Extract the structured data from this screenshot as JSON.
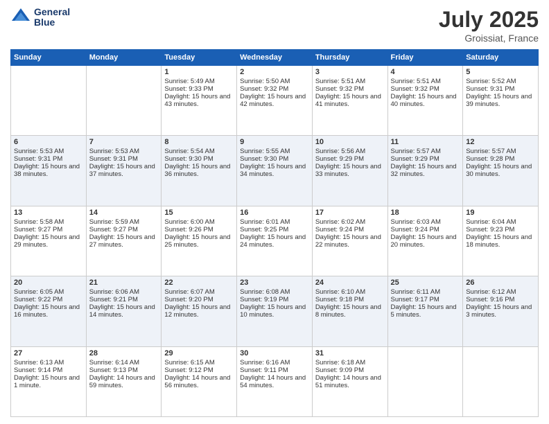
{
  "header": {
    "logo_line1": "General",
    "logo_line2": "Blue",
    "month_year": "July 2025",
    "location": "Groissiat, France"
  },
  "days_of_week": [
    "Sunday",
    "Monday",
    "Tuesday",
    "Wednesday",
    "Thursday",
    "Friday",
    "Saturday"
  ],
  "weeks": [
    [
      {
        "day": "",
        "sunrise": "",
        "sunset": "",
        "daylight": ""
      },
      {
        "day": "",
        "sunrise": "",
        "sunset": "",
        "daylight": ""
      },
      {
        "day": "1",
        "sunrise": "Sunrise: 5:49 AM",
        "sunset": "Sunset: 9:33 PM",
        "daylight": "Daylight: 15 hours and 43 minutes."
      },
      {
        "day": "2",
        "sunrise": "Sunrise: 5:50 AM",
        "sunset": "Sunset: 9:32 PM",
        "daylight": "Daylight: 15 hours and 42 minutes."
      },
      {
        "day": "3",
        "sunrise": "Sunrise: 5:51 AM",
        "sunset": "Sunset: 9:32 PM",
        "daylight": "Daylight: 15 hours and 41 minutes."
      },
      {
        "day": "4",
        "sunrise": "Sunrise: 5:51 AM",
        "sunset": "Sunset: 9:32 PM",
        "daylight": "Daylight: 15 hours and 40 minutes."
      },
      {
        "day": "5",
        "sunrise": "Sunrise: 5:52 AM",
        "sunset": "Sunset: 9:31 PM",
        "daylight": "Daylight: 15 hours and 39 minutes."
      }
    ],
    [
      {
        "day": "6",
        "sunrise": "Sunrise: 5:53 AM",
        "sunset": "Sunset: 9:31 PM",
        "daylight": "Daylight: 15 hours and 38 minutes."
      },
      {
        "day": "7",
        "sunrise": "Sunrise: 5:53 AM",
        "sunset": "Sunset: 9:31 PM",
        "daylight": "Daylight: 15 hours and 37 minutes."
      },
      {
        "day": "8",
        "sunrise": "Sunrise: 5:54 AM",
        "sunset": "Sunset: 9:30 PM",
        "daylight": "Daylight: 15 hours and 36 minutes."
      },
      {
        "day": "9",
        "sunrise": "Sunrise: 5:55 AM",
        "sunset": "Sunset: 9:30 PM",
        "daylight": "Daylight: 15 hours and 34 minutes."
      },
      {
        "day": "10",
        "sunrise": "Sunrise: 5:56 AM",
        "sunset": "Sunset: 9:29 PM",
        "daylight": "Daylight: 15 hours and 33 minutes."
      },
      {
        "day": "11",
        "sunrise": "Sunrise: 5:57 AM",
        "sunset": "Sunset: 9:29 PM",
        "daylight": "Daylight: 15 hours and 32 minutes."
      },
      {
        "day": "12",
        "sunrise": "Sunrise: 5:57 AM",
        "sunset": "Sunset: 9:28 PM",
        "daylight": "Daylight: 15 hours and 30 minutes."
      }
    ],
    [
      {
        "day": "13",
        "sunrise": "Sunrise: 5:58 AM",
        "sunset": "Sunset: 9:27 PM",
        "daylight": "Daylight: 15 hours and 29 minutes."
      },
      {
        "day": "14",
        "sunrise": "Sunrise: 5:59 AM",
        "sunset": "Sunset: 9:27 PM",
        "daylight": "Daylight: 15 hours and 27 minutes."
      },
      {
        "day": "15",
        "sunrise": "Sunrise: 6:00 AM",
        "sunset": "Sunset: 9:26 PM",
        "daylight": "Daylight: 15 hours and 25 minutes."
      },
      {
        "day": "16",
        "sunrise": "Sunrise: 6:01 AM",
        "sunset": "Sunset: 9:25 PM",
        "daylight": "Daylight: 15 hours and 24 minutes."
      },
      {
        "day": "17",
        "sunrise": "Sunrise: 6:02 AM",
        "sunset": "Sunset: 9:24 PM",
        "daylight": "Daylight: 15 hours and 22 minutes."
      },
      {
        "day": "18",
        "sunrise": "Sunrise: 6:03 AM",
        "sunset": "Sunset: 9:24 PM",
        "daylight": "Daylight: 15 hours and 20 minutes."
      },
      {
        "day": "19",
        "sunrise": "Sunrise: 6:04 AM",
        "sunset": "Sunset: 9:23 PM",
        "daylight": "Daylight: 15 hours and 18 minutes."
      }
    ],
    [
      {
        "day": "20",
        "sunrise": "Sunrise: 6:05 AM",
        "sunset": "Sunset: 9:22 PM",
        "daylight": "Daylight: 15 hours and 16 minutes."
      },
      {
        "day": "21",
        "sunrise": "Sunrise: 6:06 AM",
        "sunset": "Sunset: 9:21 PM",
        "daylight": "Daylight: 15 hours and 14 minutes."
      },
      {
        "day": "22",
        "sunrise": "Sunrise: 6:07 AM",
        "sunset": "Sunset: 9:20 PM",
        "daylight": "Daylight: 15 hours and 12 minutes."
      },
      {
        "day": "23",
        "sunrise": "Sunrise: 6:08 AM",
        "sunset": "Sunset: 9:19 PM",
        "daylight": "Daylight: 15 hours and 10 minutes."
      },
      {
        "day": "24",
        "sunrise": "Sunrise: 6:10 AM",
        "sunset": "Sunset: 9:18 PM",
        "daylight": "Daylight: 15 hours and 8 minutes."
      },
      {
        "day": "25",
        "sunrise": "Sunrise: 6:11 AM",
        "sunset": "Sunset: 9:17 PM",
        "daylight": "Daylight: 15 hours and 5 minutes."
      },
      {
        "day": "26",
        "sunrise": "Sunrise: 6:12 AM",
        "sunset": "Sunset: 9:16 PM",
        "daylight": "Daylight: 15 hours and 3 minutes."
      }
    ],
    [
      {
        "day": "27",
        "sunrise": "Sunrise: 6:13 AM",
        "sunset": "Sunset: 9:14 PM",
        "daylight": "Daylight: 15 hours and 1 minute."
      },
      {
        "day": "28",
        "sunrise": "Sunrise: 6:14 AM",
        "sunset": "Sunset: 9:13 PM",
        "daylight": "Daylight: 14 hours and 59 minutes."
      },
      {
        "day": "29",
        "sunrise": "Sunrise: 6:15 AM",
        "sunset": "Sunset: 9:12 PM",
        "daylight": "Daylight: 14 hours and 56 minutes."
      },
      {
        "day": "30",
        "sunrise": "Sunrise: 6:16 AM",
        "sunset": "Sunset: 9:11 PM",
        "daylight": "Daylight: 14 hours and 54 minutes."
      },
      {
        "day": "31",
        "sunrise": "Sunrise: 6:18 AM",
        "sunset": "Sunset: 9:09 PM",
        "daylight": "Daylight: 14 hours and 51 minutes."
      },
      {
        "day": "",
        "sunrise": "",
        "sunset": "",
        "daylight": ""
      },
      {
        "day": "",
        "sunrise": "",
        "sunset": "",
        "daylight": ""
      }
    ]
  ]
}
